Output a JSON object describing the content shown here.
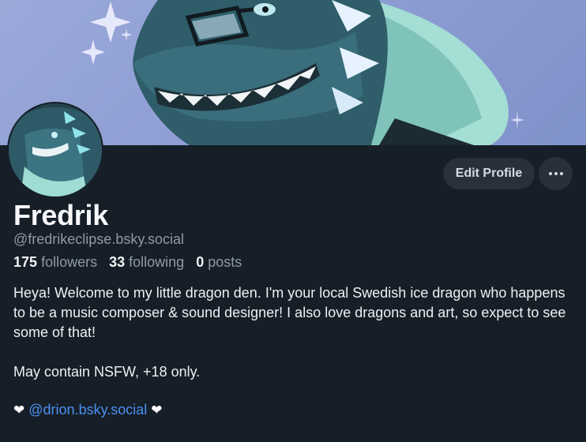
{
  "profile": {
    "display_name": "Fredrik",
    "handle": "@fredrikeclipse.bsky.social"
  },
  "actions": {
    "edit_label": "Edit Profile",
    "more_icon": "ellipsis-icon"
  },
  "stats": {
    "followers_count": "175",
    "followers_label": "followers",
    "following_count": "33",
    "following_label": "following",
    "posts_count": "0",
    "posts_label": "posts"
  },
  "bio": {
    "line1": "Heya! Welcome to my little dragon den. I'm your local Swedish ice dragon who happens to be a music composer & sound designer! I also love dragons and art, so expect to see some of that!",
    "line2": "May contain NSFW, +18 only.",
    "heart": "❤",
    "mention": "@drion.bsky.social"
  },
  "colors": {
    "background": "#161e27",
    "button": "#28313b",
    "link": "#4a90ef",
    "muted_text": "#8f9aa6"
  }
}
